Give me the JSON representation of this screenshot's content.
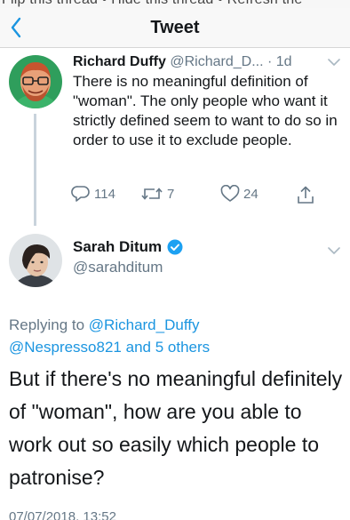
{
  "header": {
    "cut_text": "Flip this thread • Hide this thread • Refresh the",
    "title": "Tweet",
    "back_icon": "chevron-left-icon"
  },
  "colors": {
    "link": "#1b95e0",
    "muted": "#657786",
    "verified": "#1da1f2",
    "thread_line": "#c9d3dc"
  },
  "parent_tweet": {
    "author_name": "Richard Duffy",
    "handle": "@Richard_D...",
    "time": "· 1d",
    "text": "There is no meaningful definition of \"woman\". The only people who want it strictly defined seem to want to do so in order to use it to exclude people.",
    "actions": {
      "reply_count": "114",
      "retweet_count": "7",
      "like_count": "24"
    }
  },
  "main_tweet": {
    "author_name": "Sarah Ditum",
    "handle": "@sarahditum",
    "replying_prefix": "Replying to",
    "replying_user": "@Richard_Duffy",
    "replying_user2": "@Nespresso821",
    "replying_others": "and 5 others",
    "text": "But if there's no meaningful definitely of \"woman\", how are you able to work out so easily which people to patronise?",
    "timestamp": "07/07/2018, 13:52"
  }
}
